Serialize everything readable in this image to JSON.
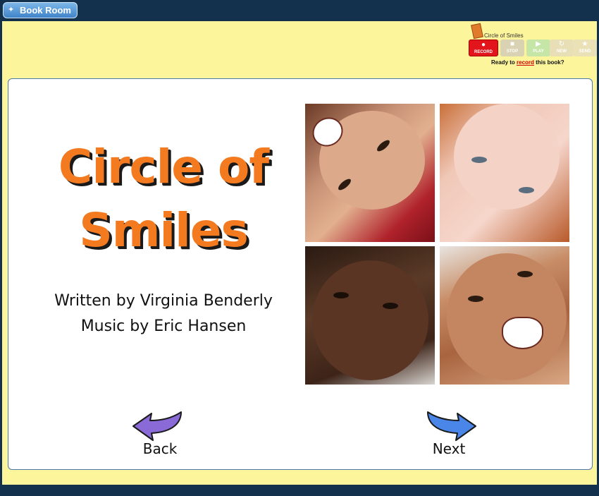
{
  "topbar": {
    "book_room_label": "Book Room"
  },
  "recorder": {
    "book_title": "Circle of Smiles",
    "buttons": [
      {
        "label": "RECORD",
        "icon": "record-dot-icon"
      },
      {
        "label": "STOP",
        "icon": "stop-square-icon"
      },
      {
        "label": "PLAY",
        "icon": "play-triangle-icon"
      },
      {
        "label": "NEW",
        "icon": "refresh-icon"
      },
      {
        "label": "SEND",
        "icon": "star-icon"
      }
    ],
    "status_prefix": "Ready to ",
    "status_link": "record",
    "status_suffix": " this book?"
  },
  "page": {
    "title_line1": "Circle of",
    "title_line2": "Smiles",
    "written_by": "Written by Virginia Benderly",
    "music_by": "Music by Eric Hansen",
    "photos": [
      "child-photo-1",
      "child-photo-2",
      "child-photo-3",
      "child-photo-4"
    ]
  },
  "nav": {
    "back_label": "Back",
    "next_label": "Next"
  },
  "colors": {
    "frame": "#fdf59c",
    "title_orange": "#f47a20",
    "back_arrow": "#8a6ad6",
    "next_arrow": "#4a86e8",
    "record_red": "#e2141c"
  }
}
